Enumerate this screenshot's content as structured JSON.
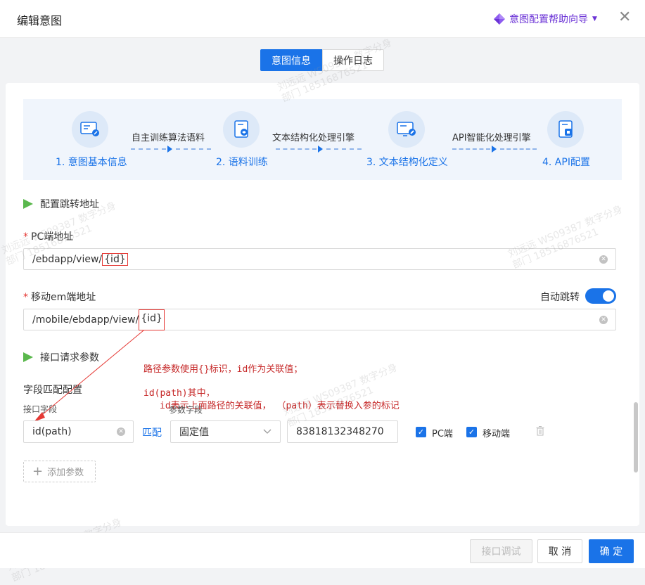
{
  "dialog": {
    "title": "编辑意图",
    "help_label": "意图配置帮助向导",
    "close_glyph": "✕"
  },
  "tabs": [
    {
      "label": "意图信息",
      "active": true
    },
    {
      "label": "操作日志",
      "active": false
    }
  ],
  "steps": [
    {
      "label": "1. 意图基本信息",
      "icon": "monitor-edit-icon"
    },
    {
      "label": "2. 语料训练",
      "icon": "document-layers-icon"
    },
    {
      "label": "3. 文本结构化定义",
      "icon": "monitor-wrench-icon"
    },
    {
      "label": "4. API配置",
      "icon": "document-api-icon"
    }
  ],
  "connectors": [
    "自主训练算法语料",
    "文本结构化处理引擎",
    "API智能化处理引擎"
  ],
  "redirect": {
    "section_title": "配置跳转地址",
    "pc_label": "PC端地址",
    "pc_value_prefix": "/ebdapp/view/",
    "pc_value_highlight": "{id}",
    "mobile_label": "移动em端地址",
    "mobile_value_prefix": "/mobile/ebdapp/view/",
    "mobile_value_highlight": "{id}",
    "auto_jump_label": "自动跳转",
    "auto_jump_on": true
  },
  "params": {
    "section_title": "接口请求参数",
    "field_match_title": "字段匹配配置",
    "api_field_label": "接口字段",
    "param_field_label": "参数字段",
    "row": {
      "api_field_value": "id(path)",
      "match_link": "匹配",
      "param_type": "固定值",
      "param_value": "83818132348270",
      "pc_label": "PC端",
      "pc_checked": true,
      "mobile_label": "移动端",
      "mobile_checked": true
    },
    "add_param_label": "添加参数"
  },
  "annotations": {
    "line1": "路径参数使用{}标识，id作为关联值；",
    "line2": "id(path)其中，",
    "line3": "id表示上面路径的关联值，  （path）表示替换入参的标记"
  },
  "watermark": {
    "name": "刘远远 WS09387 数字分身",
    "dept": "部门 18516876521"
  },
  "footer": {
    "debug_label": "接口调试",
    "cancel_label": "取 消",
    "ok_label": "确 定"
  },
  "colors": {
    "primary": "#1a73e8",
    "annotation": "#c62828",
    "help_purple": "#6b33d6",
    "section_triangle": "#5ab84d"
  }
}
